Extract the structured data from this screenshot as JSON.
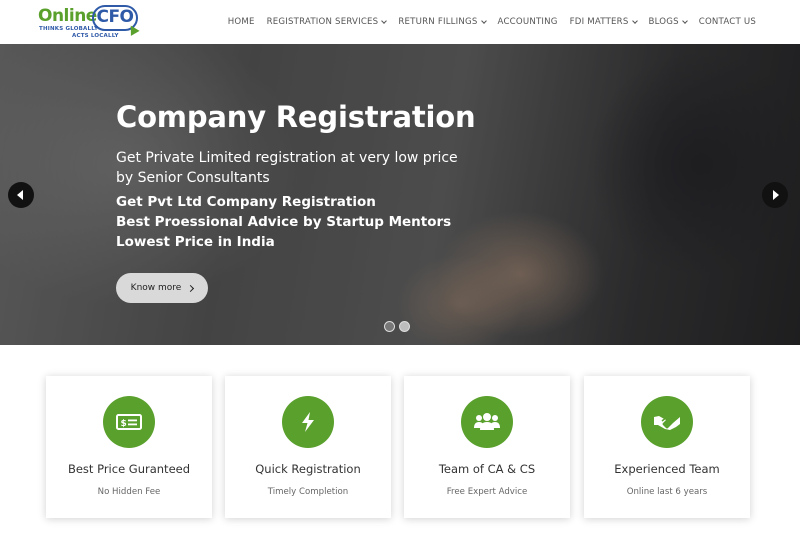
{
  "brand": {
    "name_part1": "Online",
    "name_part2": "CFO",
    "tagline_line1": "THINKS GLOBALLY",
    "tagline_line2": "ACTS LOCALLY",
    "primary_color": "#5aa02c",
    "secondary_color": "#2f5aa8"
  },
  "nav": {
    "items": [
      {
        "label": "HOME",
        "has_dropdown": false
      },
      {
        "label": "REGISTRATION SERVICES",
        "has_dropdown": true
      },
      {
        "label": "RETURN FILLINGS",
        "has_dropdown": true
      },
      {
        "label": "ACCOUNTING",
        "has_dropdown": false
      },
      {
        "label": "FDI MATTERS",
        "has_dropdown": true
      },
      {
        "label": "BLOGS",
        "has_dropdown": true
      },
      {
        "label": "CONTACT US",
        "has_dropdown": false
      }
    ]
  },
  "hero": {
    "title": "Company Registration",
    "subtitle": "Get Private Limited registration at very low price by Senior Consultants",
    "points": [
      "Get Pvt Ltd Company Registration",
      "Best Proessional Advice by Startup Mentors",
      "Lowest Price in India"
    ],
    "cta_label": "Know more",
    "slide_count": 2,
    "active_slide": 1
  },
  "features": [
    {
      "icon": "money-bill-icon",
      "title": "Best Price Guranteed",
      "text": "No Hidden Fee"
    },
    {
      "icon": "lightning-bolt-icon",
      "title": "Quick Registration",
      "text": "Timely Completion"
    },
    {
      "icon": "users-group-icon",
      "title": "Team of CA & CS",
      "text": "Free Expert Advice"
    },
    {
      "icon": "handshake-icon",
      "title": "Experienced Team",
      "text": "Online last 6 years"
    }
  ]
}
